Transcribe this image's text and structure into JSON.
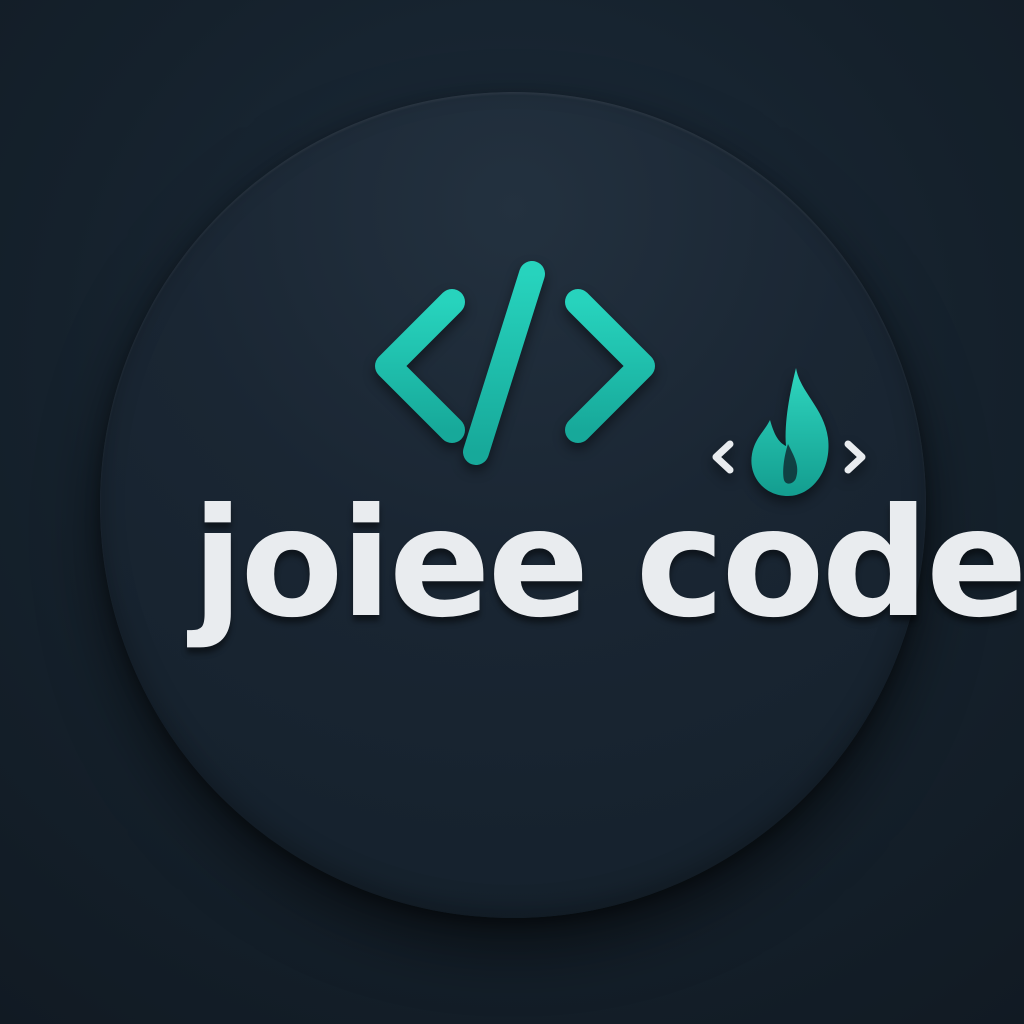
{
  "logo": {
    "wordmark": "joiee code",
    "icons": {
      "main": "code-brackets-icon",
      "small": "flame-brackets-icon"
    }
  },
  "colors": {
    "background": "#15212c",
    "badge": "#1a2633",
    "accent": "#21c4b0",
    "text": "#e9ecef"
  }
}
